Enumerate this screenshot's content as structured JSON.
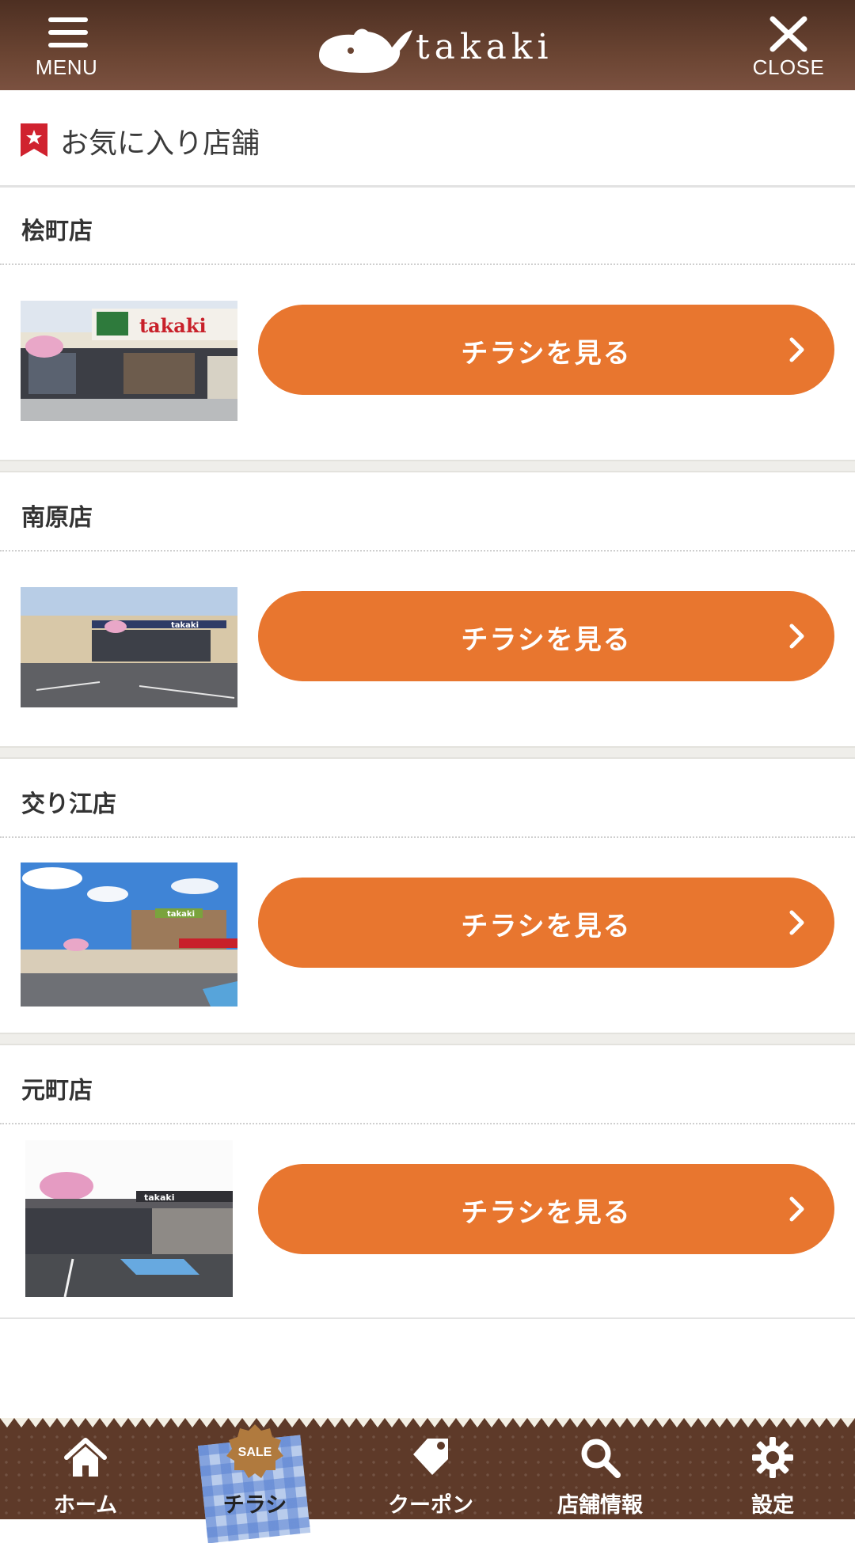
{
  "header": {
    "menu_label": "MENU",
    "close_label": "CLOSE",
    "logo_text": "takaki"
  },
  "favorites": {
    "title": "お気に入り店舗"
  },
  "stores": [
    {
      "name": "桧町店",
      "button_label": "チラシを見る"
    },
    {
      "name": "南原店",
      "button_label": "チラシを見る"
    },
    {
      "name": "交り江店",
      "button_label": "チラシを見る"
    },
    {
      "name": "元町店",
      "button_label": "チラシを見る"
    }
  ],
  "tabbar": {
    "tabs": [
      {
        "label": "ホーム",
        "icon": "home-icon"
      },
      {
        "label": "チラシ",
        "icon": "sale-badge-icon",
        "badge": "SALE",
        "active": true
      },
      {
        "label": "クーポン",
        "icon": "tag-icon"
      },
      {
        "label": "店舗情報",
        "icon": "search-icon"
      },
      {
        "label": "設定",
        "icon": "gear-icon"
      }
    ]
  },
  "colors": {
    "header_brown": "#6a4432",
    "button_orange": "#e8762f",
    "favorite_red": "#d0222f",
    "tabbar_brown": "#5e3a29"
  }
}
